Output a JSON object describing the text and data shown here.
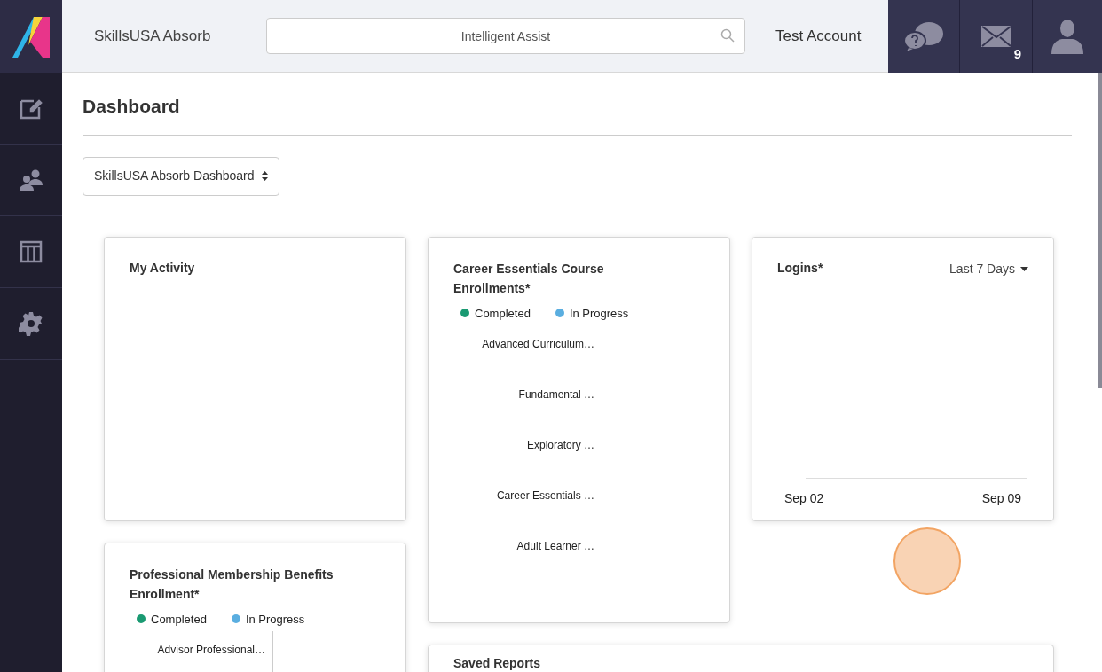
{
  "header": {
    "app_name": "SkillsUSA Absorb",
    "search": {
      "placeholder": "Intelligent Assist"
    },
    "account": "Test Account",
    "messages_count": "9"
  },
  "sidebar": {
    "items": [
      {
        "kind": "edit",
        "selected": false
      },
      {
        "kind": "users",
        "selected": false
      },
      {
        "kind": "columns",
        "selected": false
      },
      {
        "kind": "settings",
        "selected": false
      }
    ]
  },
  "page": {
    "title": "Dashboard",
    "dashboard_select": "SkillsUSA Absorb Dashboard"
  },
  "cards": {
    "my_activity": {
      "title": "My Activity"
    },
    "career": {
      "title": "Career Essentials Course Enrollments*",
      "legend": [
        {
          "label": "Completed",
          "color": "#1a9a72"
        },
        {
          "label": "In Progress",
          "color": "#5aaee0"
        }
      ],
      "categories": [
        "Advanced Curriculum…",
        "Fundamental …",
        "Exploratory …",
        "Career Essentials …",
        "Adult Learner …"
      ]
    },
    "logins": {
      "title": "Logins*",
      "range": "Last 7 Days",
      "x_labels": [
        "Sep 02",
        "Sep 09"
      ]
    },
    "membership": {
      "title": "Professional Membership Benefits Enrollment*",
      "legend": [
        {
          "label": "Completed",
          "color": "#1a9a72"
        },
        {
          "label": "In Progress",
          "color": "#5aaee0"
        }
      ],
      "categories": [
        "Advisor Professional…"
      ]
    },
    "saved_reports": {
      "title": "Saved Reports"
    }
  }
}
